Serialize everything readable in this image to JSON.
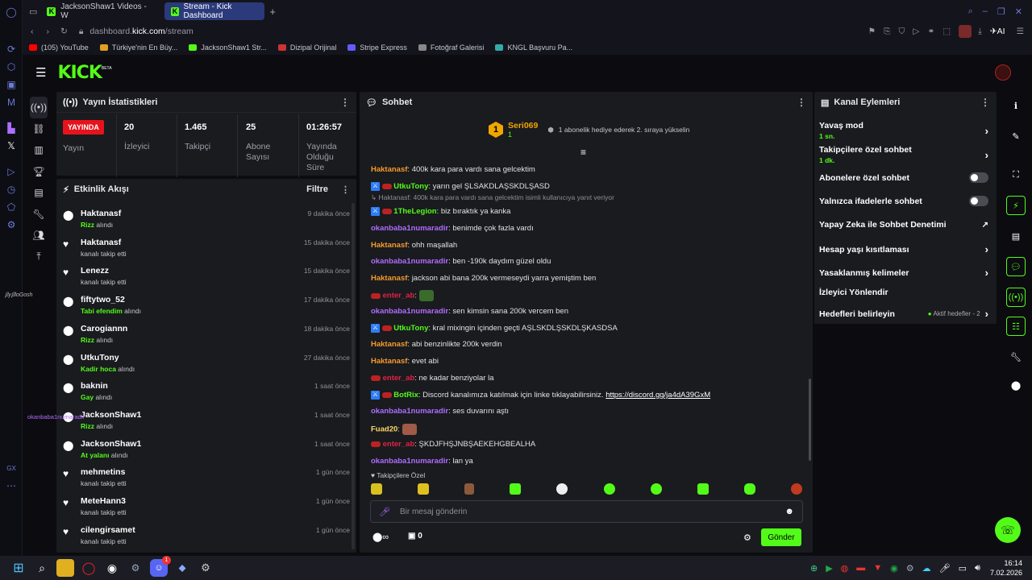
{
  "browser": {
    "tabs": [
      {
        "label": "JacksonShaw1 Videos - W",
        "active": false
      },
      {
        "label": "Stream - Kick Dashboard",
        "active": true
      }
    ],
    "url_prefix": "dashboard.",
    "url_domain": "kick.com",
    "url_path": "/stream",
    "ai_label": "AI",
    "bookmarks": [
      "(105) YouTube",
      "Türkiye'nin En Büy...",
      "JacksonShaw1 Str...",
      "Dizipal Orijinal",
      "Stripe Express",
      "Fotoğraf Galerisi",
      "KNGL Başvuru Pa..."
    ]
  },
  "kick": {
    "logo": "KICK",
    "beta": "BETA"
  },
  "stats": {
    "title": "Yayın İstatistikleri",
    "live_badge": "YAYINDA",
    "live_label": "Yayın",
    "viewers_value": "20",
    "viewers_label": "İzleyici",
    "followers_value": "1.465",
    "followers_label": "Takipçi",
    "subs_value": "25",
    "subs_label": "Abone Sayısı",
    "uptime_value": "01:26:57",
    "uptime_label": "Yayında Olduğu Süre"
  },
  "activity": {
    "title": "Etkinlik Akışı",
    "filter": "Filtre",
    "items": [
      {
        "icon": "gift",
        "name": "Haktanasf",
        "highlight": "Rizz",
        "desc": " alındı",
        "time": "9 dakika önce"
      },
      {
        "icon": "heart",
        "name": "Haktanasf",
        "highlight": "",
        "desc": "kanalı takip etti",
        "time": "15 dakika önce"
      },
      {
        "icon": "heart",
        "name": "Lenezz",
        "highlight": "",
        "desc": "kanalı takip etti",
        "time": "15 dakika önce"
      },
      {
        "icon": "gift",
        "name": "fiftytwo_52",
        "highlight": "Tabi efendim",
        "desc": " alındı",
        "time": "17 dakika önce"
      },
      {
        "icon": "gift",
        "name": "Carogiannn",
        "highlight": "Rizz",
        "desc": " alındı",
        "time": "18 dakika önce"
      },
      {
        "icon": "gift",
        "name": "UtkuTony",
        "highlight": "Kadir hoca",
        "desc": " alındı",
        "time": "27 dakika önce"
      },
      {
        "icon": "gift",
        "name": "baknin",
        "highlight": "Gay",
        "desc": " alındı",
        "time": "1 saat önce"
      },
      {
        "icon": "gift",
        "name": "JacksonShaw1",
        "highlight": "Rizz",
        "desc": " alındı",
        "time": "1 saat önce"
      },
      {
        "icon": "gift",
        "name": "JacksonShaw1",
        "highlight": "At yalanı",
        "desc": " alındı",
        "time": "1 saat önce"
      },
      {
        "icon": "heart",
        "name": "mehmetins",
        "highlight": "",
        "desc": "kanalı takip etti",
        "time": "1 gün önce"
      },
      {
        "icon": "heart",
        "name": "MeteHann3",
        "highlight": "",
        "desc": "kanalı takip etti",
        "time": "1 gün önce"
      },
      {
        "icon": "heart",
        "name": "cilengirsamet",
        "highlight": "",
        "desc": "kanalı takip etti",
        "time": "1 gün önce"
      }
    ]
  },
  "overlay_text": "okanbaba1numaradir",
  "chat": {
    "title": "Sohbet",
    "pinned_user": "Seri069",
    "pinned_count": "1",
    "pinned_text": "1 abonelik hediye ederek 2. sıraya yükselin",
    "messages": [
      {
        "user": "Haktanasf",
        "color": "o",
        "text": ": 400k kara para vardı sana gelcektim"
      },
      {
        "user": "UtkuTony",
        "color": "g",
        "text": ": yarın gel ŞLSAKDLAŞSKDLŞASD",
        "badges": true
      },
      {
        "user": "",
        "color": "",
        "text": "↳ Haktanasf: 400k kara para vardı sana gelcektim isimli kullanıcıya yanıt veriyor",
        "reply": true
      },
      {
        "user": "1TheLegion",
        "color": "g",
        "text": ": biz bıraktık ya kanka",
        "badges": true
      },
      {
        "user": "okanbaba1numaradir",
        "color": "p",
        "text": ": benimde çok fazla vardı"
      },
      {
        "user": "Haktanasf",
        "color": "o",
        "text": ": ohh maşallah"
      },
      {
        "user": "okanbaba1numaradir",
        "color": "p",
        "text": ": ben -190k daydım güzel oldu"
      },
      {
        "user": "Haktanasf",
        "color": "o",
        "text": ": jackson abi bana 200k vermeseydi yarra yemiştim ben"
      },
      {
        "user": "enter_ab",
        "color": "r",
        "text": ":",
        "emote": "#3a6b2a"
      },
      {
        "user": "okanbaba1numaradir",
        "color": "p",
        "text": ": sen kimsin sana 200k vercem ben"
      },
      {
        "user": "UtkuTony",
        "color": "g",
        "text": ": kral mixingin içinden geçti AŞLSKDLŞSKDLŞKASDSA",
        "badges": true
      },
      {
        "user": "Haktanasf",
        "color": "o",
        "text": ": abi benzinlikte 200k verdin"
      },
      {
        "user": "Haktanasf",
        "color": "o",
        "text": ": evet abi"
      },
      {
        "user": "enter_ab",
        "color": "r",
        "text": ": ne kadar benziyolar la"
      },
      {
        "user": "BotRix",
        "color": "g",
        "text": ": Discord kanalımıza katılmak için linke tıklayabilirsiniz. ",
        "link": "https://discord.gg/ja4dA39GxM",
        "badges": true
      },
      {
        "user": "okanbaba1numaradir",
        "color": "p",
        "text": ": ses duvarını aştı"
      },
      {
        "user": "Fuad20",
        "color": "y",
        "text": ":",
        "emote": "#a05a48"
      },
      {
        "user": "enter_ab",
        "color": "r",
        "text": ": ŞKDJFHŞJNBŞAEKEHGBEALHA"
      },
      {
        "user": "okanbaba1numaradir",
        "color": "p",
        "text": ": lan ya"
      }
    ],
    "followers_only": "Takipçilere Özel",
    "input_placeholder": "Bir mesaj gönderin",
    "points": "0",
    "send": "Gönder"
  },
  "actions": {
    "title": "Kanal Eylemleri",
    "items": [
      {
        "label": "Yavaş mod",
        "sub": "1 sn.",
        "control": "arrow"
      },
      {
        "label": "Takipçilere özel sohbet",
        "sub": "1 dk.",
        "control": "arrow"
      },
      {
        "label": "Abonelere özel sohbet",
        "sub": "",
        "control": "toggle"
      },
      {
        "label": "Yalnızca ifadelerle sohbet",
        "sub": "",
        "control": "toggle"
      },
      {
        "label": "Yapay Zeka ile Sohbet Denetimi",
        "sub": "",
        "control": "external"
      },
      {
        "label": "Hesap yaşı kısıtlaması",
        "sub": "",
        "control": "arrow"
      },
      {
        "label": "Yasaklanmış kelimeler",
        "sub": "",
        "control": "arrow"
      },
      {
        "label": "İzleyici Yönlendir",
        "sub": "",
        "control": "none"
      },
      {
        "label": "Hedefleri belirleyin",
        "sub": "",
        "control": "arrow",
        "extra": "Aktif hedefler - 2"
      }
    ]
  },
  "sidebar_labels": {
    "gx": "GX"
  },
  "taskbar": {
    "time": "16:14",
    "date": "7.02.2026",
    "badge": "1"
  },
  "colors": {
    "brand": "#53fc18",
    "live": "#e6131c",
    "bg": "#0b0b10",
    "panel": "#191b1f"
  }
}
